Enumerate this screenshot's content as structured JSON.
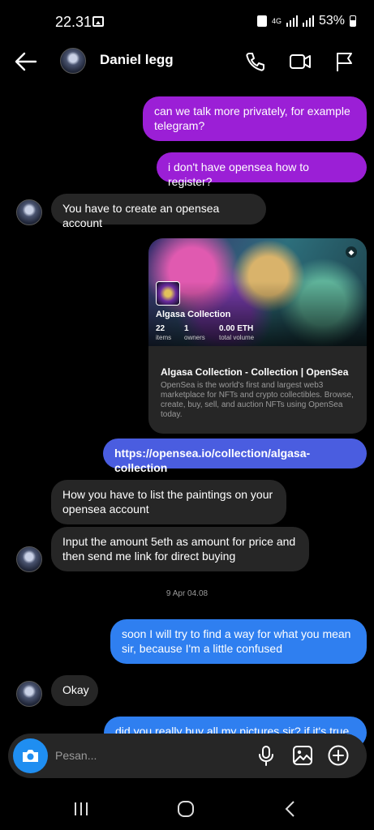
{
  "status": {
    "time": "22.31",
    "network": "4G",
    "battery": "53%"
  },
  "header": {
    "contact_name": "Daniel legg",
    "icons": [
      "back-arrow-icon",
      "phone-icon",
      "video-camera-icon",
      "flag-icon"
    ]
  },
  "messages": {
    "m1": "can we talk more privately, for example telegram?",
    "m2": "i don't have opensea how to register?",
    "m3": "You have to create an opensea account",
    "link_card": {
      "collection_name": "Algasa Collection",
      "stats": [
        {
          "value": "22",
          "label": "items"
        },
        {
          "value": "1",
          "label": "owners"
        },
        {
          "value": "0.00 ETH",
          "label": "total volume"
        }
      ],
      "title": "Algasa Collection - Collection | OpenSea",
      "description": "OpenSea is the world's first and largest web3 marketplace for NFTs and crypto collectibles. Browse, create, buy, sell, and auction NFTs using OpenSea today."
    },
    "m4": "https://opensea.io/collection/algasa-collection",
    "m5": "How you have to list the paintings on your opensea account",
    "m6": "Input the amount 5eth as amount for price and then send me link for direct buying",
    "date": "9 Apr 04.08",
    "m7": "soon I will try to find a way for what you mean sir, because I'm a little confused",
    "m8": "Okay",
    "m9": "did you really buy all my pictures sir? if it's true"
  },
  "composer": {
    "placeholder": "Pesan..."
  },
  "colors": {
    "sent_purple": "#9b1fd6",
    "sent_blue": "#2f7ff0",
    "sent_indigo": "#4a5de0",
    "received": "#262626",
    "camera": "#1f8ef1"
  }
}
